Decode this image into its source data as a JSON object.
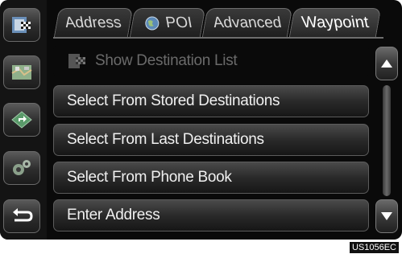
{
  "tabs": [
    {
      "label": "Address",
      "icon": "none"
    },
    {
      "label": "POI",
      "icon": "poi-globe-icon"
    },
    {
      "label": "Advanced",
      "icon": "none"
    },
    {
      "label": "Waypoint",
      "icon": "none",
      "active": true
    }
  ],
  "list": {
    "header": "Show Destination List",
    "items": [
      "Select From Stored Destinations",
      "Select From Last Destinations",
      "Select From Phone Book",
      "Enter Address"
    ]
  },
  "sidebar": {
    "buttons": [
      "destination-flag-icon",
      "map-icon",
      "route-icon",
      "settings-gear-icon",
      "back-icon"
    ]
  },
  "caption": "US1056EC"
}
